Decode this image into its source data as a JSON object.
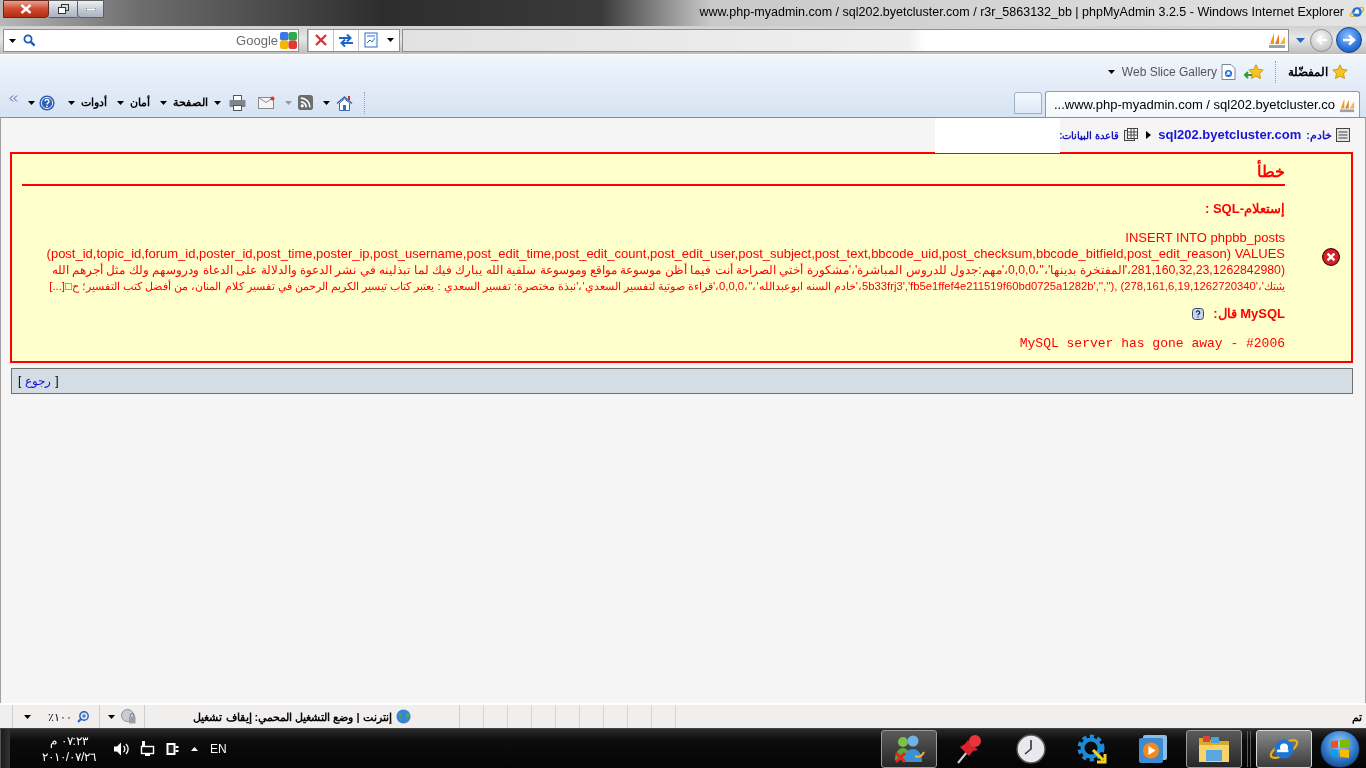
{
  "window": {
    "title": "www.php-myadmin.com / sql202.byetcluster.com / r3r_5863132_bb | phpMyAdmin 3.2.5 - Windows Internet Explorer"
  },
  "navigation": {
    "back_disabled": false,
    "forward_disabled": true
  },
  "search": {
    "placeholder": "Google"
  },
  "favorites_bar": {
    "favorites_label": "المفضّلة",
    "web_slice_gallery": "Web Slice Gallery"
  },
  "tabs": [
    {
      "label": "...www.php-myadmin.com / sql202.byetcluster.co",
      "selected": true
    }
  ],
  "command_bar": {
    "feeds_disabled": true,
    "menus": [
      {
        "label": "الصفحة"
      },
      {
        "label": "أمان"
      },
      {
        "label": "أدوات"
      }
    ]
  },
  "breadcrumb": {
    "server_label": "خادم:",
    "server": "sql202.byetcluster.com",
    "database_label": "قاعدة البيانات:"
  },
  "error": {
    "title": "خطأ",
    "query_label": "إستعلام-SQL :",
    "query_lines": [
      "INSERT INTO phpbb_posts",
      "(post_id,topic_id,forum_id,poster_id,post_time,poster_ip,post_username,post_edit_time,post_edit_count,post_edit_user,post_subject,post_text,bbcode_uid,post_checksum,bbcode_bitfield,post_edit_reason) VALUES",
      "(281,160,32,23,1262842980،'المفتخرة بدينها'،''،0,0,0،'مهم:جدول للدروس المباشرة'،'مشكورة أختي الصراحة أنت فيما أظن موسوعة مواقع وموسوعة سلفية الله يبارك فيك لما تبذلينه في نشر الدعوة والدلالة على الدعاة ودروسهم ولك مثل أجرهم الله",
      "يثبتك'،'5b33frj3','fb5e1ffef4e211519f60bd0725a1282b','',''), (278,161,6,19,1262720340،'خادم السنه ابوعبدالله'،''،0,0,0،'قراءة صوتية لتفسير السعدي'،'نبذة مختصرة: تفسير السعدي : يعتبر كتاب تيسير الكريم الرحمن في تفسير كلام المنان، من أفضل كتب التفسير؛ ح□[...]"
    ],
    "mysql_label": "MySQL قال:",
    "message": "MySQL server has gone away - #2006"
  },
  "footer": {
    "open_bracket": "[",
    "back_link": "رجوع",
    "close_bracket": "]"
  },
  "status_bar": {
    "status": "تم",
    "zone": "إنترنت | وضع التشغيل المحمي: إيقاف تشغيل",
    "zoom": "١٠٠٪"
  },
  "taskbar": {
    "buttons": [
      {
        "running": true,
        "selected": true
      },
      {
        "running": true,
        "selected": false
      },
      {
        "running": false,
        "selected": false
      },
      {
        "running": false,
        "selected": false
      },
      {
        "running": false,
        "selected": false
      },
      {
        "running": false,
        "selected": false
      },
      {
        "running": true,
        "selected": false
      }
    ],
    "language": "EN",
    "time": "٠٧:٢٣ م",
    "date": "٢٠١٠/٠٧/٢٦"
  }
}
